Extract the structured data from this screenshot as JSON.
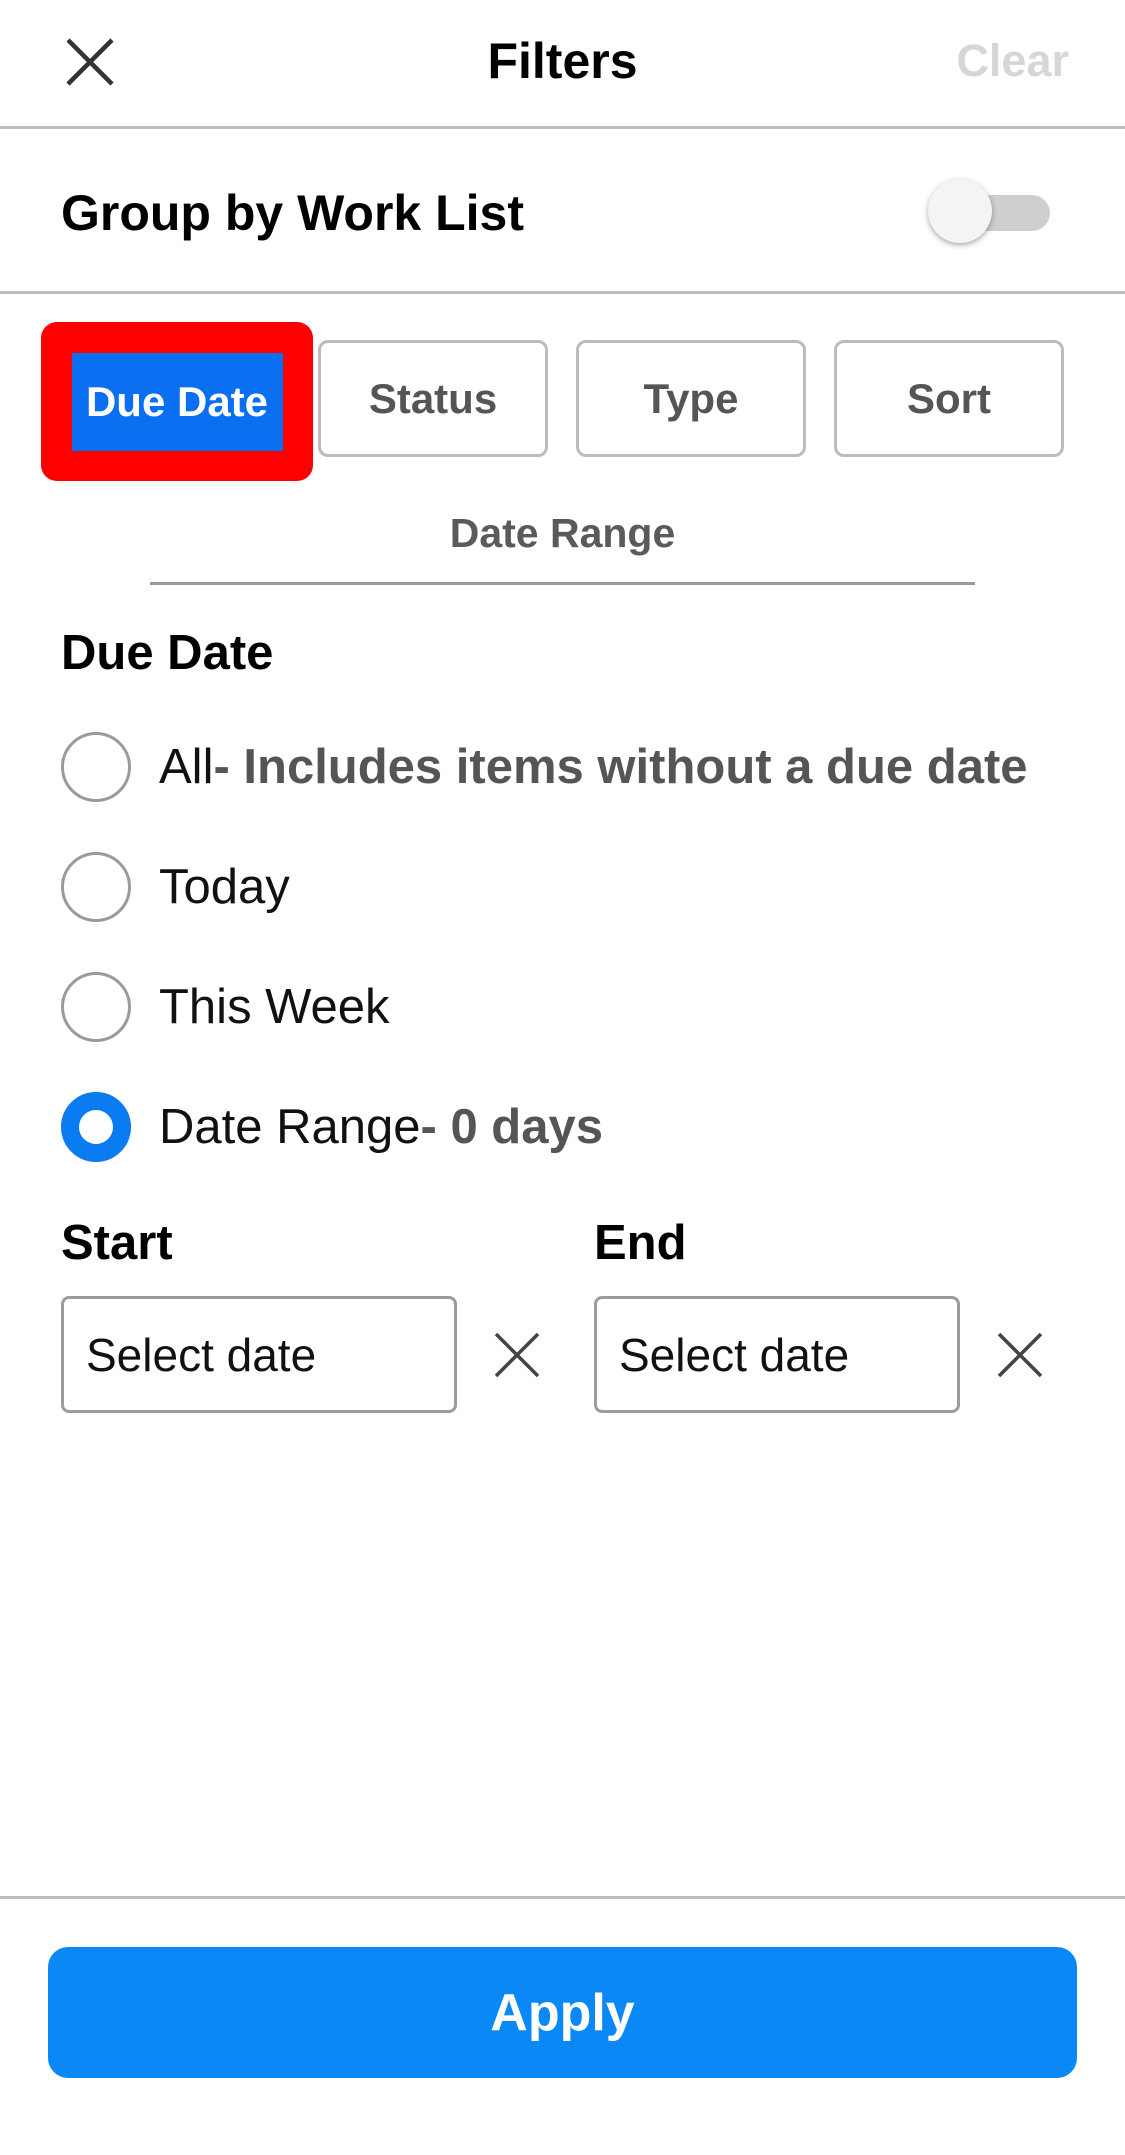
{
  "header": {
    "title": "Filters",
    "clear_label": "Clear",
    "close_icon": "close-icon"
  },
  "group_by": {
    "label": "Group by Work List",
    "enabled": false
  },
  "tabs": [
    {
      "label": "Due Date",
      "active": true
    },
    {
      "label": "Status",
      "active": false
    },
    {
      "label": "Type",
      "active": false
    },
    {
      "label": "Sort",
      "active": false
    }
  ],
  "subsection": {
    "label": "Date Range"
  },
  "due_date": {
    "title": "Due Date",
    "options": [
      {
        "label": "All",
        "extra": " - Includes items without a due date",
        "selected": false
      },
      {
        "label": "Today",
        "extra": "",
        "selected": false
      },
      {
        "label": "This Week",
        "extra": "",
        "selected": false
      },
      {
        "label": "Date Range",
        "extra": " - 0 days",
        "selected": true
      }
    ]
  },
  "range": {
    "start_label": "Start",
    "end_label": "End",
    "start_placeholder": "Select date",
    "end_placeholder": "Select date"
  },
  "footer": {
    "apply_label": "Apply"
  },
  "colors": {
    "accent": "#0a88f5",
    "active_tab": "#0a6ff0",
    "highlight_box": "#ff0000",
    "clear_disabled": "#d6d6d6"
  }
}
